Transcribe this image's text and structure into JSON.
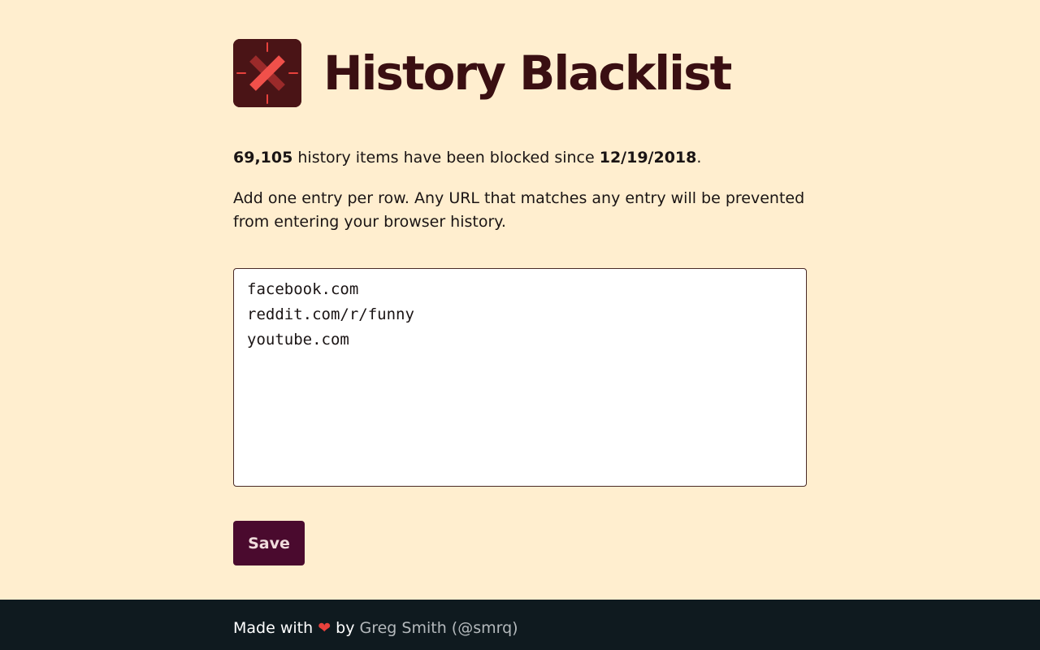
{
  "app": {
    "title": "History Blacklist",
    "logo_icon": "blocked-x-icon",
    "colors": {
      "background": "#ffeecf",
      "title": "#3a0f12",
      "logo_bg": "#4a1416",
      "logo_accent": "#e8413c",
      "button_bg": "#4a0a2e",
      "footer_bg": "#0f1a1f"
    }
  },
  "stats": {
    "count": "69,105",
    "middle_text": " history items have been blocked since ",
    "date": "12/19/2018",
    "end": "."
  },
  "description": "Add one entry per row. Any URL that matches any entry will be prevented from entering your browser history.",
  "blacklist": {
    "value": "facebook.com\nreddit.com/r/funny\nyoutube.com"
  },
  "actions": {
    "save_label": "Save"
  },
  "footer": {
    "made_with": "Made with ",
    "heart": "❤",
    "by": " by ",
    "author": "Greg Smith (@smrq)"
  }
}
